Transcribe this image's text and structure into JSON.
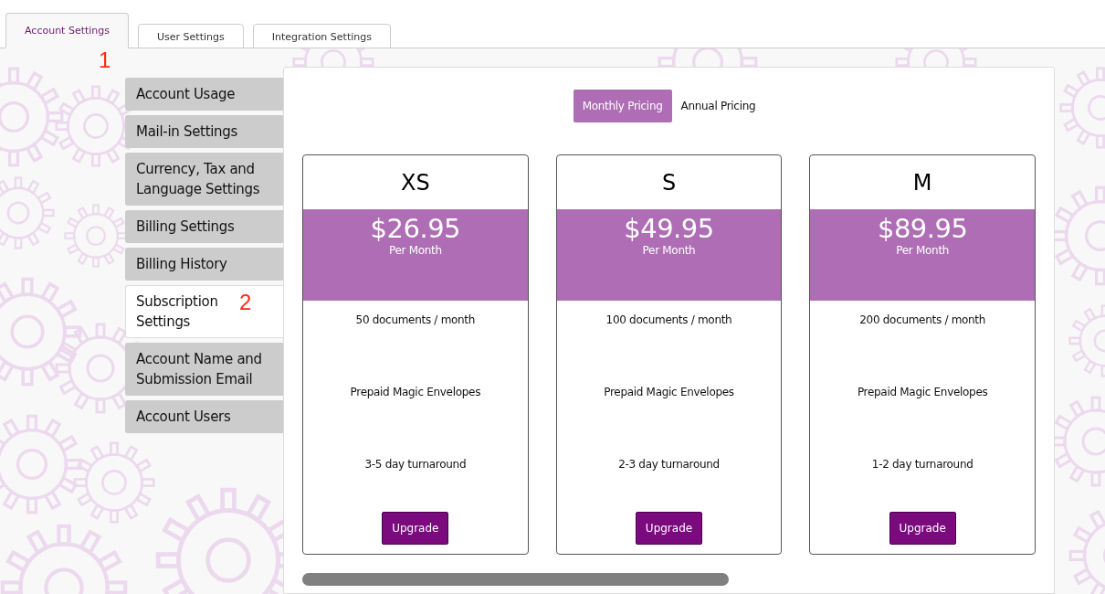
{
  "tabs": [
    {
      "label": "Account Settings",
      "selected": true,
      "marker": "1"
    },
    {
      "label": "User Settings",
      "selected": false
    },
    {
      "label": "Integration Settings",
      "selected": false
    }
  ],
  "sidebar": {
    "items": [
      {
        "label": "Account Usage",
        "selected": false
      },
      {
        "label": "Mail-in Settings",
        "selected": false
      },
      {
        "label": "Currency, Tax and Language Settings",
        "selected": false
      },
      {
        "label": "Billing Settings",
        "selected": false
      },
      {
        "label": "Billing History",
        "selected": false
      },
      {
        "label": "Subscription Settings",
        "selected": true,
        "marker": "2"
      },
      {
        "label": "Account Name and Submission Email",
        "selected": false
      },
      {
        "label": "Account Users",
        "selected": false
      }
    ]
  },
  "pricing_toggle": [
    {
      "label": "Monthly Pricing",
      "selected": true
    },
    {
      "label": "Annual Pricing",
      "selected": false
    }
  ],
  "plans": [
    {
      "name": "XS",
      "price": "$26.95",
      "period": "Per Month",
      "features": [
        "50 documents / month",
        "Prepaid Magic Envelopes",
        "3-5 day turnaround"
      ],
      "button": "Upgrade"
    },
    {
      "name": "S",
      "price": "$49.95",
      "period": "Per Month",
      "features": [
        "100 documents / month",
        "Prepaid Magic Envelopes",
        "2-3 day turnaround"
      ],
      "button": "Upgrade"
    },
    {
      "name": "M",
      "price": "$89.95",
      "period": "Per Month",
      "features": [
        "200 documents / month",
        "Prepaid Magic Envelopes",
        "1-2 day turnaround"
      ],
      "button": "Upgrade"
    }
  ]
}
